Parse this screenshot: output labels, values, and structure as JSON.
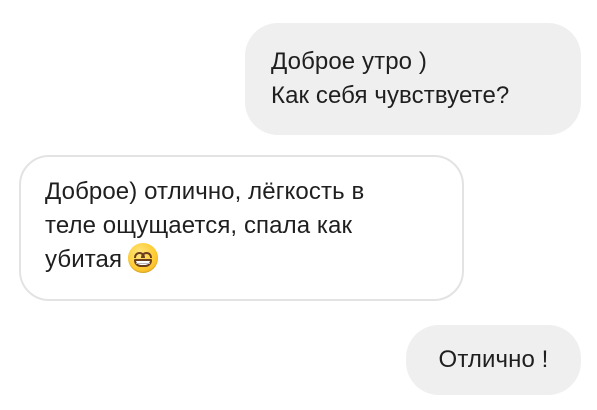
{
  "messages": [
    {
      "direction": "outgoing",
      "lines": [
        "Доброе утро )",
        "Как себя чувствуете?"
      ]
    },
    {
      "direction": "incoming",
      "lines": [
        "Доброе) отлично, лёгкость в",
        "теле ощущается, спала как",
        "убитая"
      ],
      "emoji": "grinning-face-with-smiling-eyes"
    },
    {
      "direction": "outgoing",
      "lines": [
        "Отлично !"
      ]
    }
  ],
  "colors": {
    "outgoing_bubble": "#efefef",
    "incoming_border": "#e3e3e3",
    "text": "#1f1f1f"
  }
}
